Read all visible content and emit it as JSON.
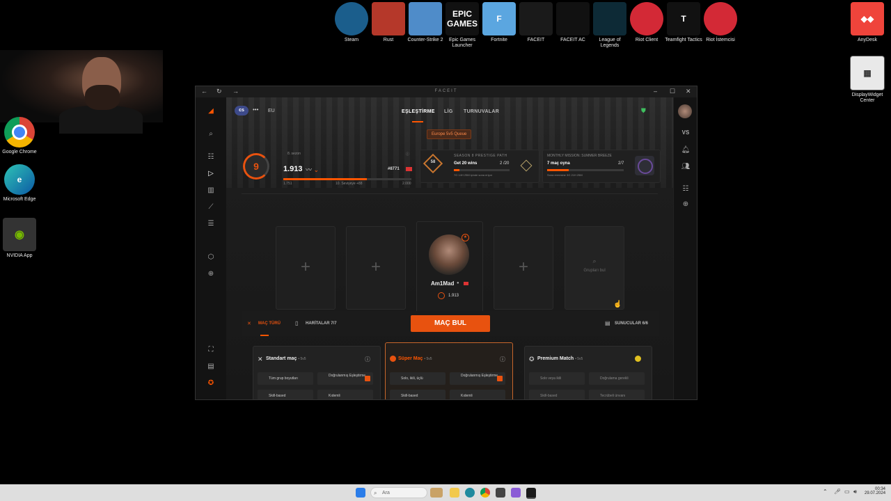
{
  "desktop": {
    "top_icons": [
      {
        "label": "Steam",
        "icon": "steam-icon",
        "color": "#1b5e8c"
      },
      {
        "label": "Rust",
        "icon": "rust-icon",
        "color": "#b5382a"
      },
      {
        "label": "Counter-Strike 2",
        "icon": "cs2-icon",
        "color": "#4f8cc9"
      },
      {
        "label": "Epic Games Launcher",
        "icon": "epic-icon",
        "color": "#111111",
        "text": "EPIC GAMES"
      },
      {
        "label": "Fortnite",
        "icon": "fortnite-icon",
        "color": "#5ba6e0",
        "text": "F"
      },
      {
        "label": "FACEIT",
        "icon": "faceit-icon",
        "color": "#1a1a1a"
      },
      {
        "label": "FACEIT AC",
        "icon": "faceit-ac-icon",
        "color": "#111111"
      },
      {
        "label": "League of Legends",
        "icon": "lol-icon",
        "color": "#0d2a36"
      },
      {
        "label": "Riot Client",
        "icon": "riot-icon",
        "color": "#d32936"
      },
      {
        "label": "Teamfight Tactics",
        "icon": "tft-icon",
        "color": "#111111",
        "text": "T"
      },
      {
        "label": "Riot İstemcisi",
        "icon": "riot-icon",
        "color": "#d32936"
      }
    ],
    "right_icons": [
      {
        "label": "AnyDesk",
        "icon": "anydesk-icon",
        "color": "#ef443b"
      },
      {
        "label": "DisplayWidget Center",
        "icon": "display-widget-icon",
        "color": "#e9e9e9"
      }
    ],
    "left_icons": [
      {
        "label": "Google Chrome",
        "icon": "chrome-icon"
      },
      {
        "label": "Microsoft Edge",
        "icon": "edge-icon"
      },
      {
        "label": "NVIDIA App",
        "icon": "nvidia-icon"
      }
    ]
  },
  "window": {
    "title": "FACEIT",
    "nav": {
      "game": "cs",
      "region": "EU",
      "tabs": [
        "EŞLEŞTİRME",
        "LİG",
        "TURNUVALAR"
      ]
    },
    "queue_banner": "Europe 5v5 Queue",
    "season": {
      "label": "8. sezon",
      "level": "9",
      "elo": "1.913",
      "rank": "#8771",
      "range_min": "1.751",
      "range_max": "2.000",
      "next": "10. Seviyeye +88",
      "progress": 0.65
    },
    "prestige": {
      "title": "SEASON 8 PRESTIGE PATH",
      "task": "Get 20 wins",
      "count": "2 /20",
      "sub": "7G 14H 25M içinde sona eriyor",
      "badge": "58",
      "progress": 0.1
    },
    "mission": {
      "title": "MONTHLY MISSION: SUMMER BREEZE",
      "task": "7 maç oyna",
      "count": "2/7",
      "sub": "Sona ermesine 3G 21H 25M",
      "progress": 0.28
    },
    "party": {
      "player_name": "Am1Mad",
      "player_elo": "1.913",
      "find_group": "Grupları bul"
    },
    "match": {
      "tabs": [
        "MAÇ TÜRÜ",
        "HARİTALAR 7/7",
        "SUNUCULAR 6/6"
      ],
      "find_button": "MAÇ BUL",
      "cards": [
        {
          "title": "Standart maç",
          "mode": "• 5v5",
          "chips": [
            "Tüm grup boyutları",
            "Doğrulanmış Eşleştirme",
            "Skill-based",
            "Kıdemli"
          ]
        },
        {
          "title": "Süper Maç",
          "mode": "• 5v5",
          "chips": [
            "Solo, ikili, üçlü",
            "Doğrulanmış Eşleştirme",
            "Skill-based",
            "Kıdemli"
          ]
        },
        {
          "title": "Premium Match",
          "mode": "• 5v5",
          "chips": [
            "Solo veya ikili",
            "Doğrulama gerekli",
            "Skill-based",
            "Tecrübeli ünvanı"
          ]
        }
      ]
    }
  },
  "taskbar": {
    "search_placeholder": "Ara",
    "time": "00:34",
    "date": "29.07.2024"
  }
}
